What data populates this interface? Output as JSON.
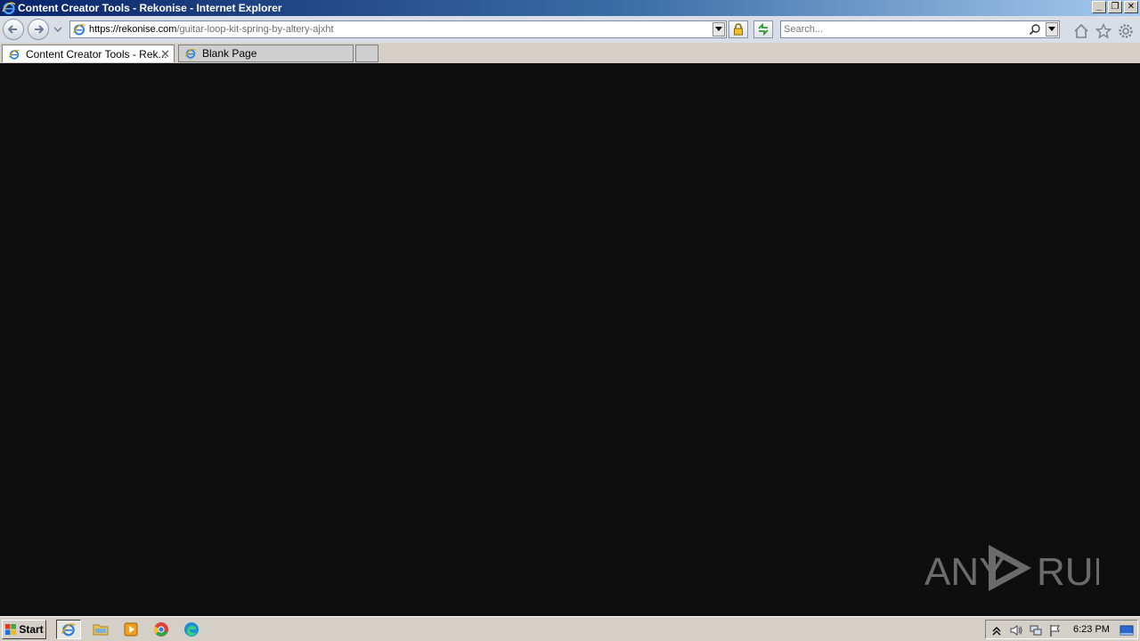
{
  "window": {
    "title": "Content Creator Tools - Rekonise - Internet Explorer",
    "minimize_label": "_",
    "restore_label": "❐",
    "close_label": "✕"
  },
  "navigation": {
    "url_host": "https://rekonise.com",
    "url_path": "/guitar-loop-kit-spring-by-altery-ajxht",
    "search_placeholder": "Search..."
  },
  "tabs": [
    {
      "label": "Content Creator Tools - Rek...",
      "active": true
    },
    {
      "label": "Blank Page",
      "active": false
    }
  ],
  "tab_close_label": "✕",
  "taskbar": {
    "start_label": "Start",
    "clock": "6:23 PM"
  },
  "watermark": {
    "left_text": "ANY",
    "right_text": "RUN"
  },
  "colors": {
    "content_bg": "#0e0e0e",
    "watermark": "#6b6b6b"
  }
}
